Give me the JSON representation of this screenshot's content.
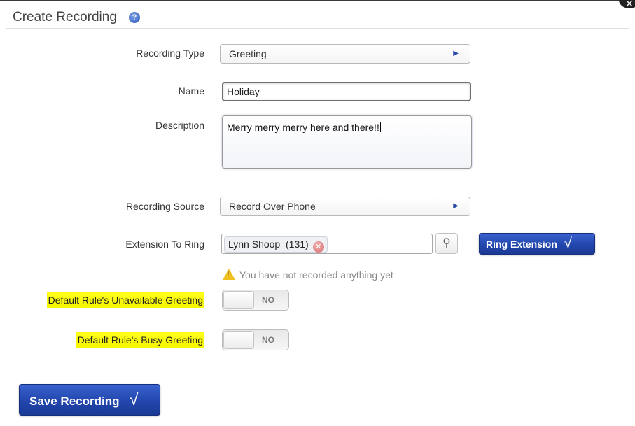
{
  "dialog": {
    "title": "Create Recording",
    "help_icon": "question-mark",
    "close_icon": "close-x"
  },
  "form": {
    "recording_type": {
      "label": "Recording Type",
      "value": "Greeting"
    },
    "name": {
      "label": "Name",
      "value": "Holiday"
    },
    "description": {
      "label": "Description",
      "value": "Merry merry merry here and there!!"
    },
    "recording_source": {
      "label": "Recording Source",
      "value": "Record Over Phone"
    },
    "extension_to_ring": {
      "label": "Extension To Ring",
      "selected": "Lynn Shoop  (131)",
      "lookup_icon": "magnifier",
      "ring_button": "Ring Extension"
    },
    "warning": {
      "icon": "warning-triangle",
      "text": "You have not recorded anything yet"
    },
    "unavailable_greeting": {
      "label": "Default Rule's Unavailable Greeting",
      "state": "NO"
    },
    "busy_greeting": {
      "label": "Default Rule's Busy Greeting",
      "state": "NO"
    }
  },
  "actions": {
    "save": "Save Recording"
  },
  "colors": {
    "button_blue": "#2246ad",
    "highlight": "#ffff1a",
    "arrow_blue": "#2646a8"
  }
}
